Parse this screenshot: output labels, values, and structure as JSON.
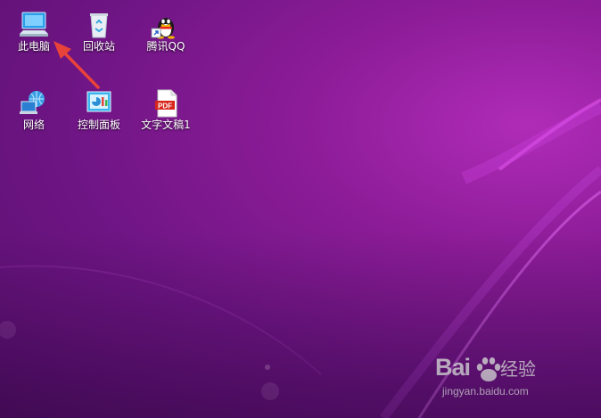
{
  "desktop": {
    "icons": [
      {
        "label": "此电脑",
        "icon": "computer-icon"
      },
      {
        "label": "回收站",
        "icon": "recycle-bin-icon"
      },
      {
        "label": "腾讯QQ",
        "icon": "qq-penguin-icon"
      },
      {
        "label": "网络",
        "icon": "network-icon"
      },
      {
        "label": "控制面板",
        "icon": "control-panel-icon"
      },
      {
        "label": "文字文稿1",
        "icon": "pdf-document-icon"
      }
    ],
    "annotation": {
      "icon": "red-arrow-icon",
      "color": "#e8433a"
    }
  },
  "watermark": {
    "brand": "Bai",
    "brand_suffix": "经验",
    "domain": "jingyan.baidu.com"
  },
  "colors": {
    "wallpaper_base": "#6e1584",
    "wallpaper_glow": "#c23ad0",
    "label_text": "#ffffff"
  }
}
